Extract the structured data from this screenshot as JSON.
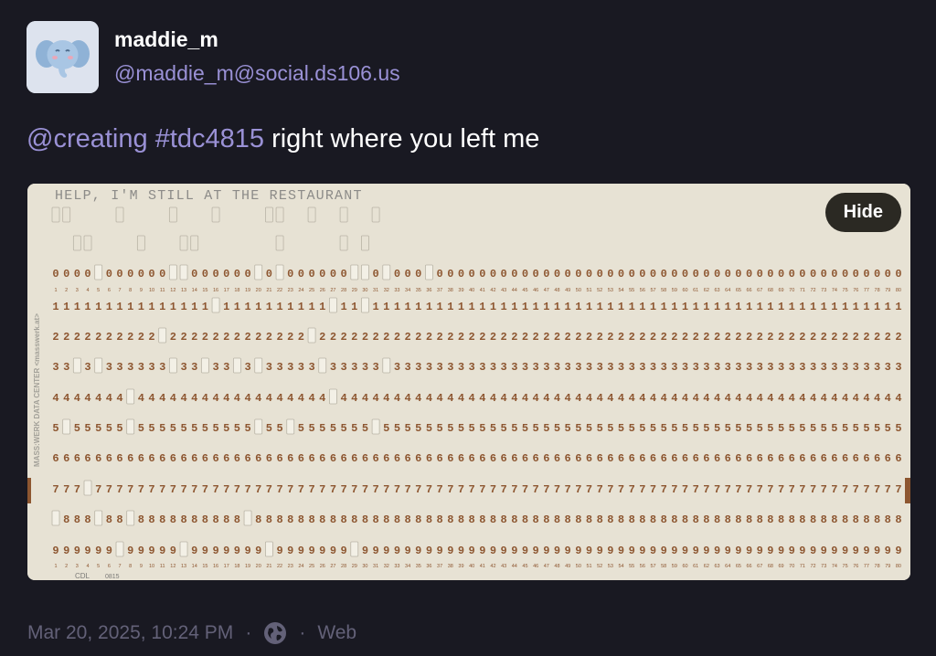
{
  "author": {
    "display_name": "maddie_m",
    "handle": "@maddie_m@social.ds106.us",
    "avatar": "elephant-avatar-icon"
  },
  "status": {
    "mention": "@creating",
    "hashtag": "#tdc4815",
    "text": " right where you left me"
  },
  "media": {
    "hide_label": "Hide",
    "card": {
      "printed_text": "HELP, I'M STILL AT THE RESTAURANT",
      "side_text": "MASS:WERK DATA CENTER <masswerk.at>",
      "footer_code": "CDL",
      "footer_number": "0815",
      "digit_rows": [
        "0",
        "1",
        "2",
        "3",
        "4",
        "5",
        "6",
        "7",
        "8",
        "9"
      ]
    }
  },
  "meta": {
    "timestamp": "Mar 20, 2025, 10:24 PM",
    "separator": "·",
    "visibility_icon": "globe-icon",
    "client": "Web"
  },
  "colors": {
    "background": "#191922",
    "accent": "#9a91d6",
    "card": "#e7e2d4",
    "punch_digits": "#8d5630"
  }
}
